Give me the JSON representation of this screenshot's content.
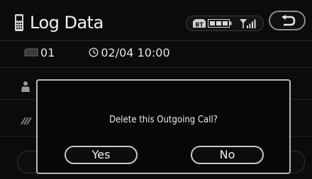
{
  "header": {
    "title": "Log Data",
    "status": {
      "bluetooth_label": "BT",
      "battery_icon": "battery-icon",
      "signal_icon": "signal-strength-icon"
    },
    "back_icon": "u-turn-back-arrow-icon"
  },
  "log": {
    "memory_number": "01",
    "datetime": "02/04 10:00"
  },
  "dialog": {
    "message": "Delete this Outgoing Call?",
    "yes_label": "Yes",
    "no_label": "No"
  },
  "colors": {
    "background": "#0b0b0b",
    "text": "#ececec",
    "border": "#b9b9b9"
  }
}
